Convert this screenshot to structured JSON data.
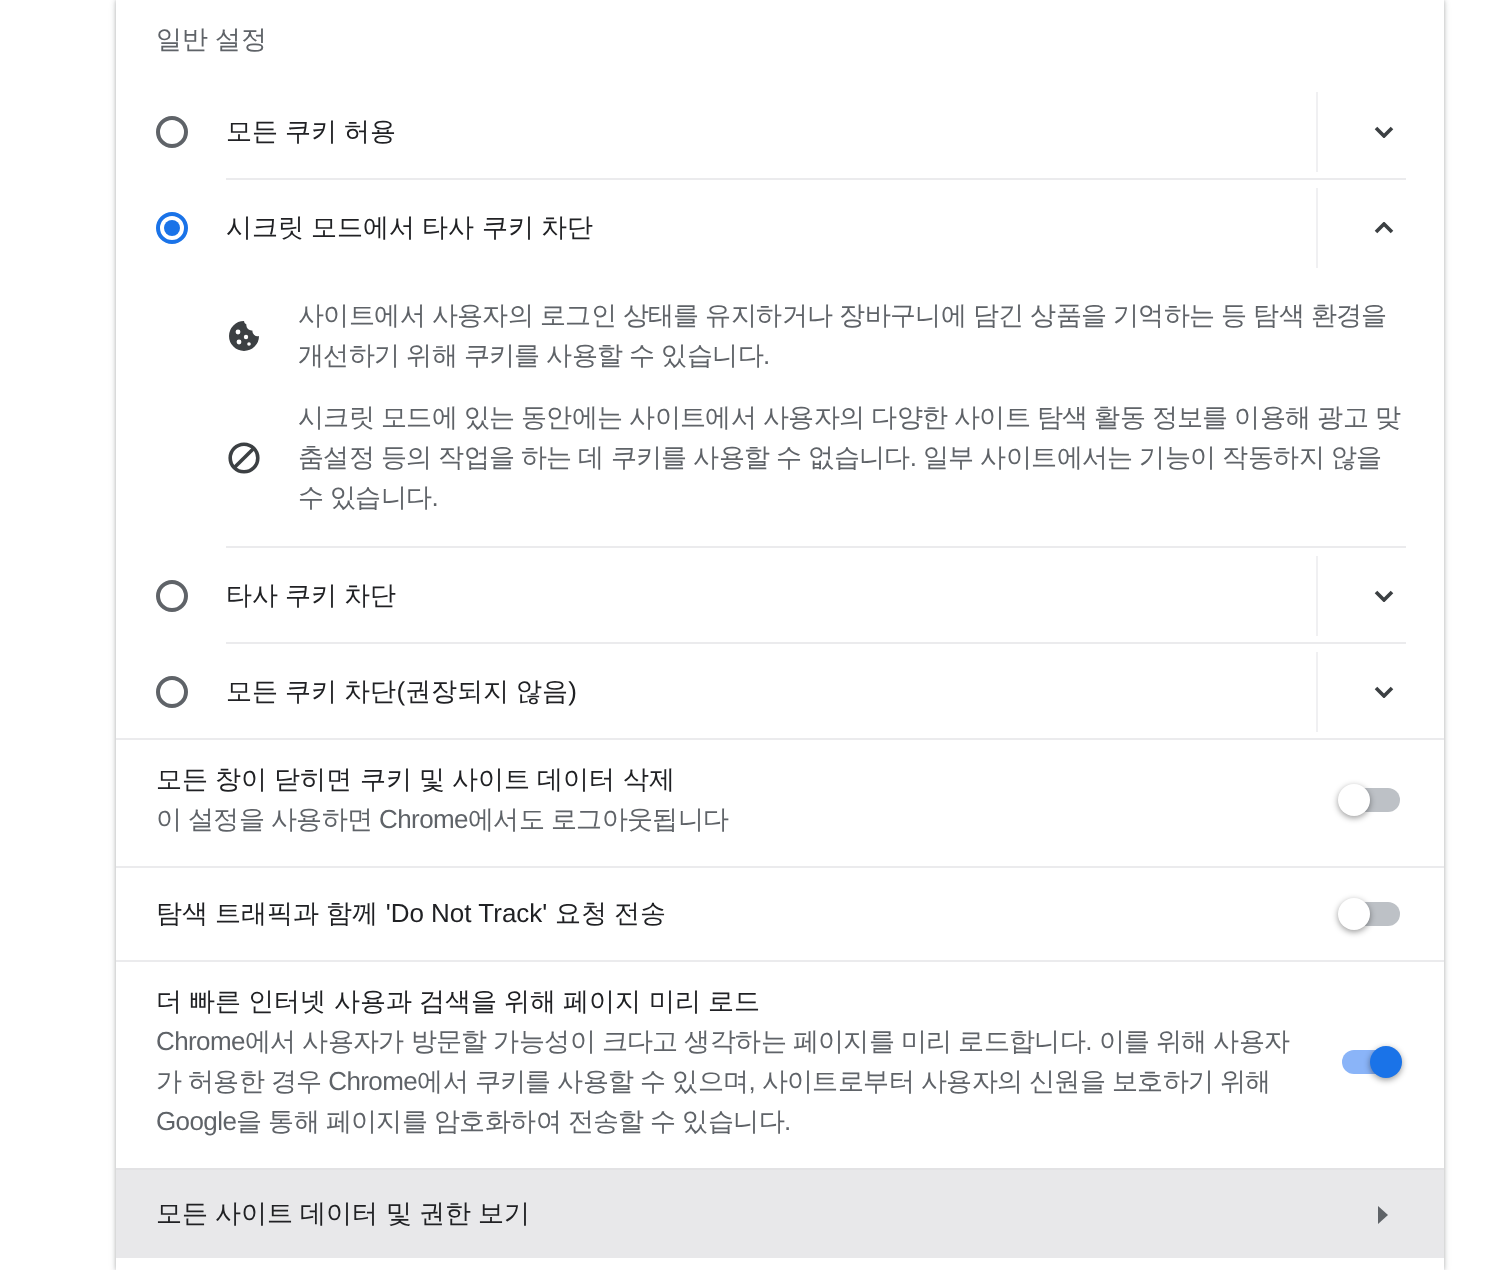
{
  "section_title": "일반 설정",
  "cookie_options": [
    {
      "label": "모든 쿠키 허용",
      "selected": false,
      "expanded": false
    },
    {
      "label": "시크릿 모드에서 타사 쿠키 차단",
      "selected": true,
      "expanded": true,
      "details": [
        {
          "kind": "cookie",
          "text": "사이트에서 사용자의 로그인 상태를 유지하거나 장바구니에 담긴 상품을 기억하는 등 탐색 환경을 개선하기 위해 쿠키를 사용할 수 있습니다."
        },
        {
          "kind": "blocked",
          "text": "시크릿 모드에 있는 동안에는 사이트에서 사용자의 다양한 사이트 탐색 활동 정보를 이용해 광고 맞춤설정 등의 작업을 하는 데 쿠키를 사용할 수 없습니다. 일부 사이트에서는 기능이 작동하지 않을 수 있습니다."
        }
      ]
    },
    {
      "label": "타사 쿠키 차단",
      "selected": false,
      "expanded": false
    },
    {
      "label": "모든 쿠키 차단(권장되지 않음)",
      "selected": false,
      "expanded": false
    }
  ],
  "toggles": [
    {
      "title": "모든 창이 닫히면 쿠키 및 사이트 데이터 삭제",
      "description": "이 설정을 사용하면 Chrome에서도 로그아웃됩니다",
      "on": false
    },
    {
      "title": "탐색 트래픽과 함께 'Do Not Track' 요청 전송",
      "on": false
    },
    {
      "title": "더 빠른 인터넷 사용과 검색을 위해 페이지 미리 로드",
      "description": "Chrome에서 사용자가 방문할 가능성이 크다고 생각하는 페이지를 미리 로드합니다. 이를 위해 사용자가 허용한 경우 Chrome에서 쿠키를 사용할 수 있으며, 사이트로부터 사용자의 신원을 보호하기 위해 Google을 통해 페이지를 암호화하여 전송할 수 있습니다.",
      "on": true
    }
  ],
  "link_row": {
    "label": "모든 사이트 데이터 및 권한 보기"
  }
}
